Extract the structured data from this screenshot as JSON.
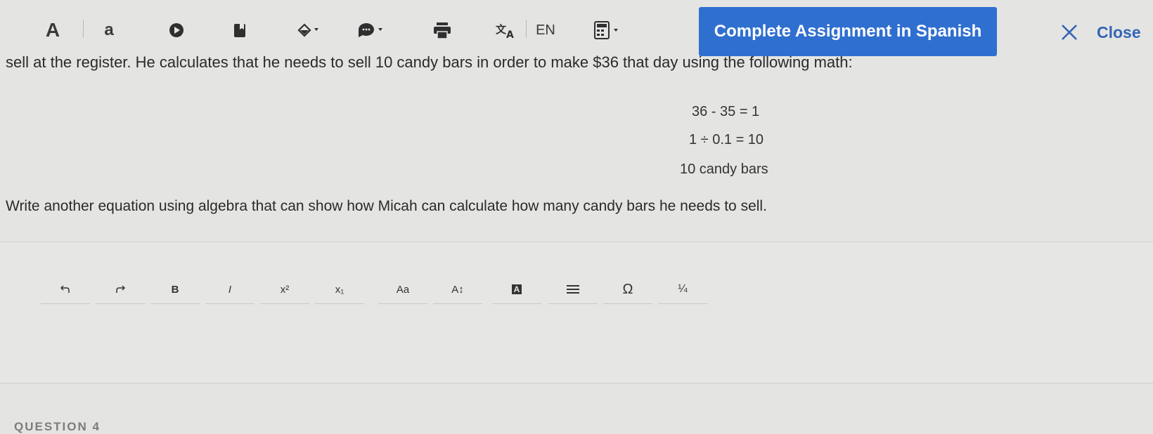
{
  "toolbar": {
    "large_a": "A",
    "small_a": "a",
    "lang": "EN",
    "spanish_button": "Complete Assignment in Spanish",
    "close_label": "Close"
  },
  "content": {
    "passage": "sell at the register. He calculates that he needs to sell 10 candy bars in order to make $36 that day using the following math:",
    "equations": [
      "36 - 35 = 1",
      "1 ÷ 0.1 = 10",
      "10 candy bars"
    ],
    "prompt": "Write another equation using algebra that can show how Micah can calculate how many candy bars he needs to sell."
  },
  "editor": {
    "bold": "B",
    "italic": "I",
    "superscript": "x²",
    "subscript": "x₁",
    "font_case": "Aa",
    "font_size": "A↕",
    "text_color": "A",
    "omega": "Ω",
    "fraction": "¼"
  },
  "next_section": "QUESTION 4",
  "colors": {
    "accent": "#2f6fd0",
    "background": "#e4e5e3",
    "link": "#3564b5"
  }
}
